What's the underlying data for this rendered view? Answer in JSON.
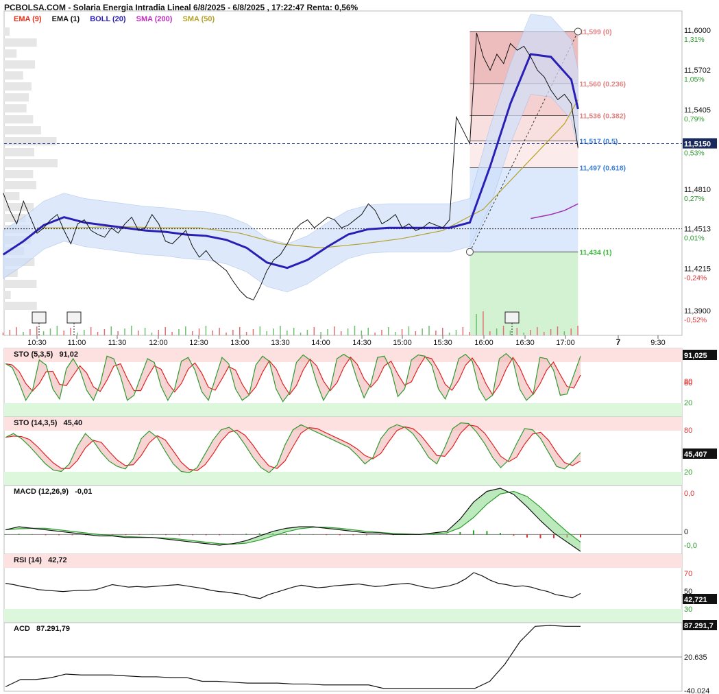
{
  "header": {
    "title": "PCBOLSA.COM - Solaria Energia Intradia Lineal 6/8/2025 - 6/8/2025 , 17:22:47 Renta: 0,56%"
  },
  "legend": [
    {
      "label": "EMA (9)",
      "color": "#e8301c"
    },
    {
      "label": "EMA (1)",
      "color": "#111111"
    },
    {
      "label": "BOLL (20)",
      "color": "#2a1fb5"
    },
    {
      "label": "SMA (200)",
      "color": "#c02cc0"
    },
    {
      "label": "SMA (50)",
      "color": "#b5a22a"
    }
  ],
  "colors": {
    "price": "#111111",
    "boll_mid": "#2a1fb5",
    "boll_band": "#cfe0fa",
    "sma50": "#b5a22a",
    "sma200": "#a030b0",
    "up": "#2c9a2c",
    "down": "#d83030"
  },
  "chart_data": [
    {
      "type": "line",
      "name_panel": "price",
      "x_ticks": [
        "10:30",
        "11:00",
        "11:30",
        "12:00",
        "12:30",
        "13:00",
        "13:30",
        "14:00",
        "14:30",
        "15:00",
        "15:30",
        "16:00",
        "16:30",
        "17:00",
        "7",
        "9:30"
      ],
      "y_ticks": [
        {
          "value": "11,6000",
          "pct": "1,31%"
        },
        {
          "value": "11,5702",
          "pct": "1,05%"
        },
        {
          "value": "11,5405",
          "pct": "0,79%"
        },
        {
          "value": "11,5150",
          "pct": "0,53%"
        },
        {
          "value": "11,4810",
          "pct": "0,27%"
        },
        {
          "value": "11,4513",
          "pct": "0,01%"
        },
        {
          "value": "11,4215",
          "pct": "-0,24%"
        },
        {
          "value": "11,3900",
          "pct": "-0,52%"
        }
      ],
      "ylim": [
        11.39,
        11.6
      ],
      "last_price": "11,5150",
      "reference_close": 11.4513,
      "fibonacci": [
        {
          "label": "11,599 (0)",
          "value": 11.599,
          "color": "#e08080"
        },
        {
          "label": "11,560 (0.236)",
          "value": 11.56,
          "color": "#e08080"
        },
        {
          "label": "11,536 (0.382)",
          "value": 11.536,
          "color": "#e08080"
        },
        {
          "label": "11,517 (0.5)",
          "value": 11.517,
          "color": "#3a7ed8"
        },
        {
          "label": "11,497 (0.618)",
          "value": 11.497,
          "color": "#3a7ed8"
        },
        {
          "label": "11,434 (1)",
          "value": 11.434,
          "color": "#38b838"
        }
      ],
      "series": [
        {
          "name": "EMA (1)",
          "x": [
            "10:05",
            "10:10",
            "10:15",
            "10:20",
            "10:25",
            "10:30",
            "10:35",
            "10:40",
            "10:45",
            "10:50",
            "10:55",
            "11:00",
            "11:05",
            "11:10",
            "11:15",
            "11:20",
            "11:25",
            "11:30",
            "11:35",
            "11:40",
            "11:45",
            "11:50",
            "11:55",
            "12:00",
            "12:05",
            "12:10",
            "12:15",
            "12:20",
            "12:25",
            "12:30",
            "12:35",
            "12:40",
            "12:45",
            "12:50",
            "12:55",
            "13:00",
            "13:05",
            "13:10",
            "13:15",
            "13:20",
            "13:25",
            "13:30",
            "13:35",
            "13:40",
            "13:45",
            "13:50",
            "13:55",
            "14:00",
            "14:05",
            "14:10",
            "14:15",
            "14:20",
            "14:25",
            "14:30",
            "14:35",
            "14:40",
            "14:45",
            "14:50",
            "14:55",
            "15:00",
            "15:05",
            "15:10",
            "15:15",
            "15:20",
            "15:25",
            "15:30",
            "15:35",
            "15:40",
            "15:45",
            "15:50",
            "15:55",
            "16:00",
            "16:05",
            "16:10",
            "16:15",
            "16:20",
            "16:25",
            "16:30",
            "16:35",
            "16:40",
            "16:45",
            "16:50",
            "16:55",
            "17:00",
            "17:05",
            "17:10"
          ],
          "values": [
            11.478,
            11.465,
            11.455,
            11.472,
            11.46,
            11.448,
            11.452,
            11.458,
            11.462,
            11.45,
            11.44,
            11.455,
            11.458,
            11.45,
            11.447,
            11.445,
            11.452,
            11.448,
            11.455,
            11.46,
            11.45,
            11.452,
            11.462,
            11.455,
            11.442,
            11.44,
            11.445,
            11.45,
            11.438,
            11.43,
            11.435,
            11.428,
            11.424,
            11.42,
            11.412,
            11.405,
            11.4,
            11.398,
            11.408,
            11.42,
            11.428,
            11.432,
            11.44,
            11.45,
            11.455,
            11.458,
            11.452,
            11.456,
            11.46,
            11.458,
            11.452,
            11.454,
            11.458,
            11.462,
            11.47,
            11.465,
            11.455,
            11.458,
            11.462,
            11.452,
            11.455,
            11.45,
            11.452,
            11.456,
            11.454,
            11.452,
            11.458,
            11.535,
            11.525,
            11.515,
            11.598,
            11.58,
            11.57,
            11.582,
            11.575,
            11.59,
            11.585,
            11.588,
            11.58,
            11.57,
            11.565,
            11.555,
            11.548,
            11.552,
            11.545,
            11.512
          ]
        },
        {
          "name": "BOLL (20)",
          "x": [
            "10:05",
            "10:20",
            "10:35",
            "10:50",
            "11:05",
            "11:20",
            "11:35",
            "11:50",
            "12:05",
            "12:20",
            "12:35",
            "12:50",
            "13:05",
            "13:20",
            "13:35",
            "13:50",
            "14:05",
            "14:20",
            "14:35",
            "14:50",
            "15:05",
            "15:20",
            "15:35",
            "15:50",
            "16:05",
            "16:20",
            "16:35",
            "16:50",
            "17:05",
            "17:10"
          ],
          "values": [
            11.432,
            11.442,
            11.454,
            11.46,
            11.456,
            11.454,
            11.452,
            11.45,
            11.449,
            11.447,
            11.446,
            11.443,
            11.437,
            11.426,
            11.422,
            11.428,
            11.438,
            11.447,
            11.451,
            11.452,
            11.452,
            11.452,
            11.452,
            11.456,
            11.498,
            11.545,
            11.582,
            11.58,
            11.563,
            11.541
          ]
        },
        {
          "name": "SMA (50)",
          "x": [
            "10:30",
            "11:00",
            "11:30",
            "12:00",
            "12:30",
            "13:00",
            "13:30",
            "14:00",
            "14:30",
            "15:00",
            "15:30",
            "16:00",
            "16:30",
            "17:00",
            "17:10"
          ],
          "values": [
            11.452,
            11.452,
            11.453,
            11.452,
            11.452,
            11.448,
            11.44,
            11.437,
            11.44,
            11.444,
            11.45,
            11.466,
            11.498,
            11.53,
            11.548
          ]
        },
        {
          "name": "SMA (200)",
          "x": [
            "16:35",
            "16:50",
            "17:00",
            "17:10"
          ],
          "values": [
            11.459,
            11.462,
            11.465,
            11.47
          ]
        }
      ]
    },
    {
      "type": "line",
      "title": "STO (5,3,5)",
      "value_label": "91,02",
      "last_value": "91,025",
      "levels": [
        "80",
        "50",
        "20"
      ],
      "series": [
        {
          "name": "%K",
          "values": [
            80,
            74,
            50,
            22,
            38,
            86,
            78,
            40,
            24,
            72,
            88,
            70,
            38,
            22,
            48,
            92,
            88,
            60,
            22,
            30,
            60,
            88,
            82,
            44,
            22,
            40,
            84,
            90,
            70,
            36,
            22,
            56,
            90,
            80,
            40,
            22,
            30,
            78,
            92,
            84,
            40,
            20,
            34,
            82,
            94,
            86,
            50,
            22,
            40,
            88,
            95,
            88,
            54,
            26,
            48,
            90,
            92,
            70,
            28,
            40,
            86,
            94,
            92,
            78,
            40,
            24,
            50,
            88,
            95,
            84,
            40,
            22,
            30,
            88,
            96,
            86,
            40,
            22,
            32,
            90,
            88,
            70,
            30,
            32,
            62,
            92
          ]
        }
      ]
    },
    {
      "type": "line",
      "title": "STO (14,3,5)",
      "value_label": "45,40",
      "last_value": "45,407",
      "levels": [
        "80",
        "50",
        "20"
      ],
      "series": [
        {
          "name": "%K",
          "values": [
            72,
            78,
            70,
            58,
            44,
            30,
            20,
            18,
            30,
            58,
            78,
            66,
            48,
            34,
            26,
            22,
            38,
            70,
            82,
            72,
            50,
            30,
            18,
            16,
            24,
            46,
            68,
            84,
            88,
            78,
            60,
            40,
            24,
            16,
            28,
            60,
            84,
            92,
            86,
            80,
            74,
            68,
            62,
            56,
            44,
            30,
            40,
            70,
            86,
            92,
            88,
            78,
            60,
            40,
            30,
            56,
            86,
            95,
            94,
            80,
            62,
            40,
            24,
            36,
            62,
            86,
            84,
            70,
            48,
            26,
            22,
            34,
            48
          ]
        }
      ]
    },
    {
      "type": "line",
      "title": "MACD (12,26,9)",
      "value_label": "-0,01",
      "levels": [
        "0,0",
        "0",
        "-0,0"
      ],
      "series": [
        {
          "name": "MACD",
          "values": [
            0.3,
            0.5,
            0.4,
            0.3,
            0.2,
            0.1,
            0.0,
            -0.1,
            -0.1,
            -0.2,
            -0.2,
            -0.2,
            -0.3,
            -0.4,
            -0.5,
            -0.6,
            -0.7,
            -0.6,
            -0.4,
            -0.1,
            0.2,
            0.4,
            0.5,
            0.5,
            0.4,
            0.3,
            0.2,
            0.1,
            0.1,
            0.0,
            0.0,
            0.0,
            0.1,
            0.2,
            1.0,
            2.1,
            2.8,
            3.0,
            2.6,
            1.8,
            0.9,
            0.1,
            -0.5,
            -1.1
          ]
        }
      ]
    },
    {
      "type": "line",
      "title": "RSI (14)",
      "value_label": "42,72",
      "last_value": "42,721",
      "levels": [
        "70",
        "50",
        "30"
      ],
      "series": [
        {
          "name": "RSI",
          "values": [
            58,
            56,
            53,
            51,
            48,
            47,
            46,
            45,
            46,
            47,
            47,
            48,
            52,
            56,
            54,
            52,
            53,
            52,
            53,
            54,
            55,
            56,
            54,
            52,
            50,
            47,
            45,
            44,
            42,
            40,
            36,
            34,
            40,
            44,
            48,
            52,
            55,
            53,
            51,
            52,
            54,
            55,
            56,
            57,
            55,
            53,
            54,
            56,
            57,
            58,
            55,
            52,
            50,
            52,
            54,
            58,
            65,
            75,
            70,
            63,
            58,
            56,
            53,
            54,
            52,
            48,
            45,
            40,
            38,
            35,
            42
          ]
        }
      ]
    },
    {
      "type": "line",
      "title": "ACD",
      "value_label": "87.291,79",
      "last_value": "87.291,7",
      "mid_label": "20.635",
      "low_label": "-40.024",
      "series": [
        {
          "name": "ACD",
          "values": [
            20,
            28,
            28,
            30,
            34,
            33,
            33,
            33,
            32,
            31,
            31,
            30,
            30,
            26,
            26,
            25,
            24,
            24,
            24,
            23,
            23,
            22,
            22,
            22,
            22,
            18,
            18,
            18,
            18,
            18,
            18,
            18,
            26,
            45,
            70,
            87,
            88,
            87,
            87
          ]
        }
      ]
    }
  ]
}
